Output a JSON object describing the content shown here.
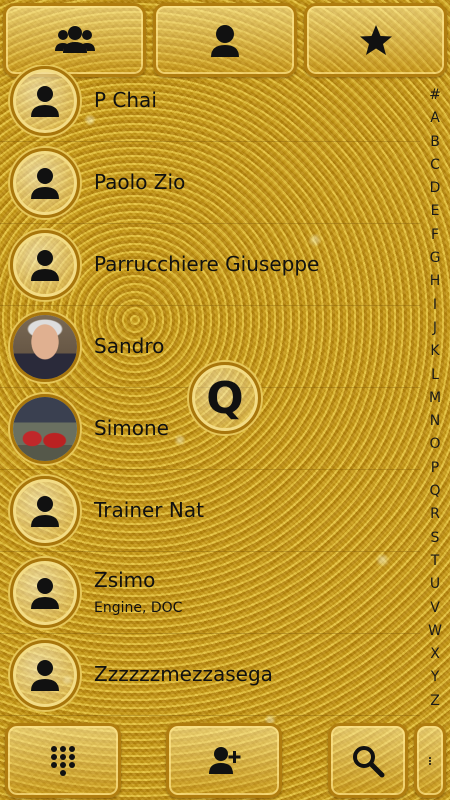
{
  "tabs": [
    {
      "icon": "groups-icon"
    },
    {
      "icon": "contact-icon"
    },
    {
      "icon": "star-icon"
    }
  ],
  "contacts": [
    {
      "name": "P Chai",
      "subtitle": "",
      "avatar": "default-avatar-icon"
    },
    {
      "name": "Paolo Zio",
      "subtitle": "",
      "avatar": "default-avatar-icon"
    },
    {
      "name": "Parrucchiere Giuseppe",
      "subtitle": "",
      "avatar": "default-avatar-icon"
    },
    {
      "name": "Sandro",
      "subtitle": "",
      "avatar": "photo"
    },
    {
      "name": "Simone",
      "subtitle": "",
      "avatar": "photo"
    },
    {
      "name": "Trainer Nat",
      "subtitle": "",
      "avatar": "default-avatar-icon"
    },
    {
      "name": "Zsimo",
      "subtitle": "Engine, DOC",
      "avatar": "default-avatar-icon"
    },
    {
      "name": "Zzzzzzmezzasega",
      "subtitle": "",
      "avatar": "default-avatar-icon"
    }
  ],
  "index_letters": [
    "#",
    "A",
    "B",
    "C",
    "D",
    "E",
    "F",
    "G",
    "H",
    "I",
    "J",
    "K",
    "L",
    "M",
    "N",
    "O",
    "P",
    "Q",
    "R",
    "S",
    "T",
    "U",
    "V",
    "W",
    "X",
    "Y",
    "Z"
  ],
  "current_letter": "Q",
  "bottom_actions": [
    {
      "icon": "dialpad-icon"
    },
    {
      "icon": "add-contact-icon"
    },
    {
      "icon": "search-icon"
    },
    {
      "icon": "overflow-menu-icon"
    }
  ],
  "colors": {
    "gold": "#d4a520",
    "frame": "#b07d10",
    "ink": "#111111"
  }
}
